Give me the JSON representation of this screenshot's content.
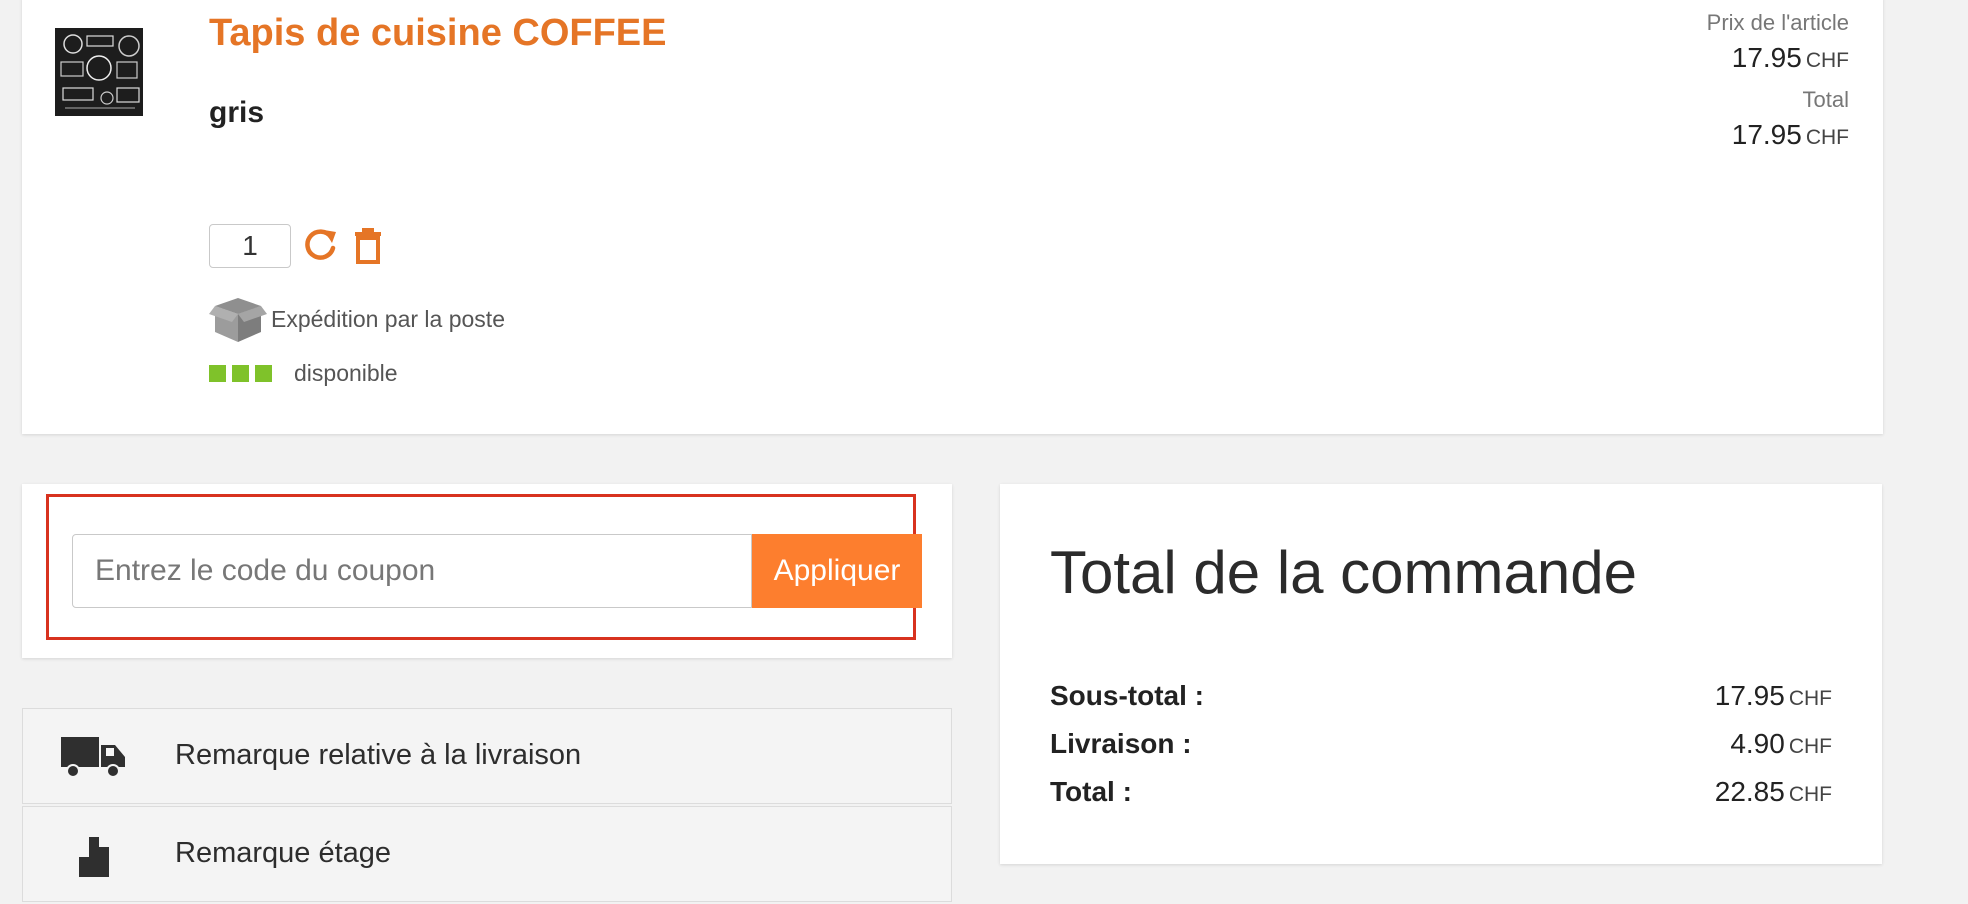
{
  "product": {
    "title": "Tapis de cuisine COFFEE",
    "variant": "gris",
    "thumb_alt": "coffee-mat-thumbnail",
    "unit_price_label": "Prix de l'article",
    "unit_price": "17.95",
    "total_label": "Total",
    "total": "17.95",
    "currency": "CHF",
    "quantity": "1",
    "shipping_text": "Expédition par la poste",
    "stock_text": "disponible",
    "stock_color": "#7fc22a",
    "icons": [
      "refresh-icon",
      "trash-icon",
      "box-icon"
    ]
  },
  "coupon": {
    "placeholder": "Entrez le code du coupon",
    "button_label": "Appliquer",
    "highlight_color": "#d8321f",
    "button_color": "#fd7e2e"
  },
  "remarks": [
    {
      "label": "Remarque relative à la livraison",
      "icon": "truck-icon"
    },
    {
      "label": "Remarque étage",
      "icon": "stairs-icon"
    }
  ],
  "order_total": {
    "title": "Total de la commande",
    "currency": "CHF",
    "rows": [
      {
        "label": "Sous-total :",
        "value": "17.95"
      },
      {
        "label": "Livraison :",
        "value": "4.90"
      },
      {
        "label": "Total :",
        "value": "22.85"
      }
    ]
  },
  "accent_color": "#e57526"
}
